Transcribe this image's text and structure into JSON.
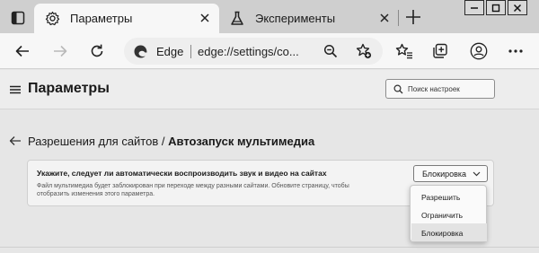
{
  "browser": {
    "tabs": [
      {
        "label": "Параметры",
        "icon": "gear-icon",
        "active": true
      },
      {
        "label": "Эксперименты",
        "icon": "flask-icon",
        "active": false
      }
    ],
    "address_bar": {
      "site_label": "Edge",
      "url": "edge://settings/co..."
    }
  },
  "settings": {
    "title": "Параметры",
    "search_placeholder": "Поиск настроек",
    "breadcrumb": {
      "parent": "Разрешения для сайтов",
      "separator": "/",
      "current": "Автозапуск мультимедиа"
    },
    "card": {
      "title": "Укажите, следует ли автоматически воспроизводить звук и видео на сайтах",
      "description": "Файл мультимедиа будет заблокирован при переходе между разными сайтами. Обновите страницу, чтобы отобразить изменения этого параметра."
    },
    "select": {
      "value": "Блокировка",
      "options": [
        "Разрешить",
        "Ограничить",
        "Блокировка"
      ],
      "selected_index": 2
    }
  }
}
